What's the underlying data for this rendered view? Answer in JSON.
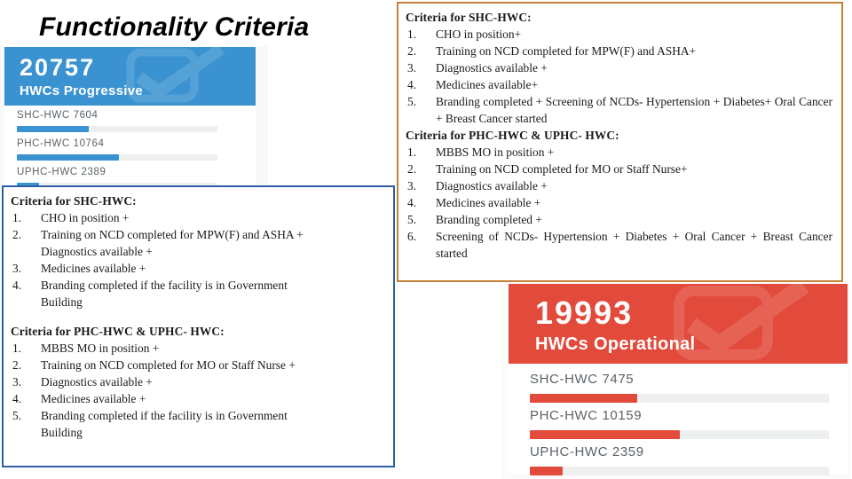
{
  "slide": {
    "title": "Functionality Criteria"
  },
  "widget_progressive": {
    "number": "20757",
    "subtitle": "HWCs Progressive",
    "icon": "check-mark-watermark",
    "color": "#3a93d0",
    "metrics": [
      {
        "label": "SHC-HWC 7604",
        "value": 7604,
        "percent": 36
      },
      {
        "label": "PHC-HWC 10764",
        "value": 10764,
        "percent": 51
      },
      {
        "label": "UPHC-HWC 2389",
        "value": 2389,
        "percent": 11
      }
    ]
  },
  "widget_operational": {
    "number": "19993",
    "subtitle": "HWCs Operational",
    "icon": "check-mark-watermark",
    "color": "#e24b3c",
    "metrics": [
      {
        "label": "SHC-HWC 7475",
        "value": 7475,
        "percent": 36
      },
      {
        "label": "PHC-HWC 10159",
        "value": 10159,
        "percent": 50
      },
      {
        "label": "UPHC-HWC 2359",
        "value": 2359,
        "percent": 11
      }
    ]
  },
  "criteria_right": {
    "border_color": "#c5813a",
    "section_1": {
      "heading": "Criteria for SHC-HWC:",
      "items": [
        {
          "num": "1.",
          "text": "CHO in position+"
        },
        {
          "num": "2.",
          "text": "Training on NCD completed for MPW(F) and ASHA+"
        },
        {
          "num": "3.",
          "text": "Diagnostics available +"
        },
        {
          "num": "4.",
          "text": "Medicines available+"
        },
        {
          "num": "5.",
          "text": "Branding completed + Screening of NCDs- Hypertension + Diabetes+ Oral Cancer + Breast Cancer started"
        }
      ]
    },
    "section_2": {
      "heading": "Criteria for PHC-HWC & UPHC- HWC:",
      "items": [
        {
          "num": "1.",
          "text": "MBBS MO in position +"
        },
        {
          "num": "2.",
          "text": "Training on NCD completed for MO or Staff Nurse+"
        },
        {
          "num": "3.",
          "text": "Diagnostics available +"
        },
        {
          "num": "4.",
          "text": "Medicines available +"
        },
        {
          "num": "5.",
          "text": "Branding completed +"
        },
        {
          "num": "6.",
          "text": "Screening of NCDs-  Hypertension + Diabetes + Oral Cancer + Breast Cancer started"
        }
      ]
    }
  },
  "criteria_left": {
    "border_color": "#2e5fa3",
    "section_1": {
      "heading": "Criteria for SHC-HWC:",
      "items": [
        {
          "num": "1.",
          "text": "CHO in position +"
        },
        {
          "num": "2.",
          "text": "Training on NCD completed for MPW(F) and ASHA +",
          "text2": "Diagnostics available +"
        },
        {
          "num": "3.",
          "text": "Medicines available +"
        },
        {
          "num": "4.",
          "text": "Branding completed if the facility is in Government",
          "text2": "Building"
        }
      ]
    },
    "section_2": {
      "heading": "Criteria for PHC-HWC & UPHC- HWC:",
      "items": [
        {
          "num": "1.",
          "text": "MBBS MO in position +"
        },
        {
          "num": "2.",
          "text": "Training on NCD completed for MO or Staff Nurse +"
        },
        {
          "num": "3.",
          "text": "Diagnostics available +"
        },
        {
          "num": "4.",
          "text": "Medicines available +"
        },
        {
          "num": "5.",
          "text": "Branding completed if the facility is in Government",
          "text2": "Building"
        }
      ]
    }
  }
}
